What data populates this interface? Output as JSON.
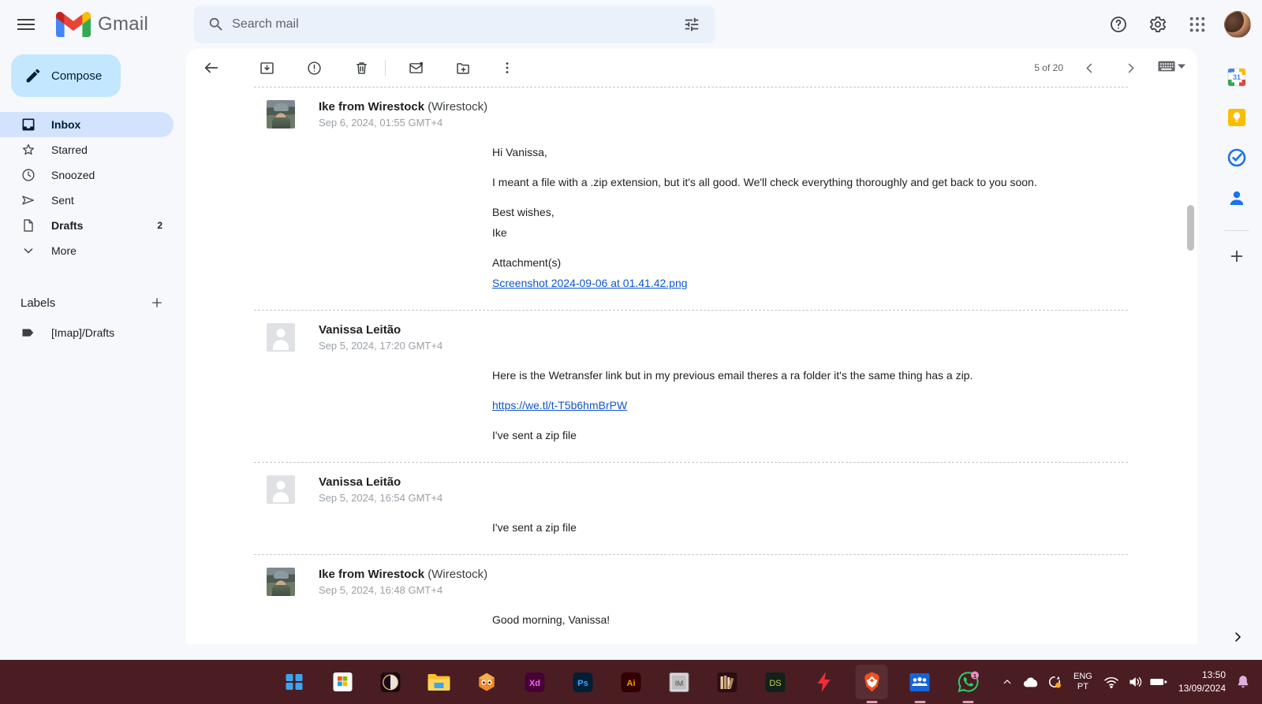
{
  "app": {
    "brand": "Gmail",
    "menu_icon": "hamburger-icon"
  },
  "search": {
    "placeholder": "Search mail",
    "value": "",
    "search_icon": "search-icon",
    "filter_icon": "tune-filter-icon"
  },
  "header_actions": {
    "help": "Support",
    "settings": "Settings",
    "apps": "Google apps",
    "account": "Google Account"
  },
  "sidebar": {
    "compose_label": "Compose",
    "items": [
      {
        "label": "Inbox",
        "icon": "inbox-icon",
        "count": "",
        "active": true
      },
      {
        "label": "Starred",
        "icon": "star-icon",
        "count": "",
        "active": false
      },
      {
        "label": "Snoozed",
        "icon": "clock-icon",
        "count": "",
        "active": false
      },
      {
        "label": "Sent",
        "icon": "send-icon",
        "count": "",
        "active": false
      },
      {
        "label": "Drafts",
        "icon": "document-icon",
        "count": "2",
        "active": false
      },
      {
        "label": "More",
        "icon": "chevron-down-icon",
        "count": "",
        "active": false
      }
    ],
    "labels_title": "Labels",
    "labels_add": "+",
    "labels": [
      {
        "label": "[Imap]/Drafts",
        "icon": "label-tag-icon"
      }
    ]
  },
  "toolbar": {
    "back": "Back to Inbox",
    "archive": "Archive",
    "spam": "Report spam",
    "delete": "Delete",
    "unread": "Mark as unread",
    "move": "Move to",
    "more": "More",
    "page_count": "5 of 20",
    "prev": "Newer",
    "next": "Older",
    "keyboard": "Input tools"
  },
  "thread": {
    "messages": [
      {
        "sender": "Ike from Wirestock",
        "org": "(Wirestock)",
        "date": "Sep 6, 2024, 01:55 GMT+4",
        "avatar": "photo",
        "body": [
          "Hi Vanissa,",
          "I meant a file with a .zip extension, but it's all good. We'll check everything thoroughly and get back to you soon.",
          "Best wishes,",
          "Ike"
        ],
        "attachment_label": "Attachment(s)",
        "attachment_name": "Screenshot 2024-09-06 at 01.41.42.png"
      },
      {
        "sender": "Vanissa Leitão",
        "org": "",
        "date": "Sep 5, 2024, 17:20 GMT+4",
        "avatar": "generic",
        "body": [
          "Here is the Wetransfer link but in my previous email theres a ra folder it's the same thing has a zip."
        ],
        "link": "https://we.tl/t-T5b6hmBrPW",
        "body_after": [
          "I've sent a zip file"
        ]
      },
      {
        "sender": "Vanissa Leitão",
        "org": "",
        "date": "Sep 5, 2024, 16:54 GMT+4",
        "avatar": "generic",
        "body": [
          "I've sent a zip file"
        ]
      },
      {
        "sender": "Ike from Wirestock",
        "org": "(Wirestock)",
        "date": "Sep 5, 2024, 16:48 GMT+4",
        "avatar": "photo",
        "body": [
          "Good morning, Vanissa!"
        ]
      }
    ]
  },
  "right_panel": {
    "items": [
      {
        "name": "google-calendar-icon",
        "label": "Calendar",
        "day": "31"
      },
      {
        "name": "google-keep-icon",
        "label": "Keep"
      },
      {
        "name": "google-tasks-icon",
        "label": "Tasks"
      },
      {
        "name": "google-contacts-icon",
        "label": "Contacts"
      }
    ],
    "add_label": "Get add-ons",
    "expand_label": "Show side panel"
  },
  "taskbar": {
    "apps": [
      {
        "name": "windows-start-icon",
        "label": "Start",
        "running": false,
        "focused": false,
        "badge": ""
      },
      {
        "name": "microsoft-store-icon",
        "label": "Microsoft Store",
        "running": false,
        "focused": false,
        "badge": ""
      },
      {
        "name": "lightroom-icon",
        "label": "Lightroom",
        "running": false,
        "focused": false,
        "badge": ""
      },
      {
        "name": "file-explorer-icon",
        "label": "File Explorer",
        "running": false,
        "focused": false,
        "badge": ""
      },
      {
        "name": "owl-app-icon",
        "label": "Topaz",
        "running": false,
        "focused": false,
        "badge": ""
      },
      {
        "name": "adobe-xd-icon",
        "label": "Adobe XD",
        "running": false,
        "focused": false,
        "badge": ""
      },
      {
        "name": "photoshop-icon",
        "label": "Adobe Photoshop",
        "running": false,
        "focused": false,
        "badge": ""
      },
      {
        "name": "illustrator-icon",
        "label": "Adobe Illustrator",
        "running": false,
        "focused": false,
        "badge": ""
      },
      {
        "name": "indesign-icon",
        "label": "Adobe InDesign",
        "running": false,
        "focused": false,
        "badge": ""
      },
      {
        "name": "books-icon",
        "label": "Library",
        "running": false,
        "focused": false,
        "badge": ""
      },
      {
        "name": "ds-app-icon",
        "label": "DS",
        "running": false,
        "focused": false,
        "badge": ""
      },
      {
        "name": "flash-icon",
        "label": "Flash",
        "running": false,
        "focused": false,
        "badge": ""
      },
      {
        "name": "brave-browser-icon",
        "label": "Brave",
        "running": true,
        "focused": true,
        "badge": ""
      },
      {
        "name": "contacts-app-icon",
        "label": "People",
        "running": true,
        "focused": false,
        "badge": ""
      },
      {
        "name": "whatsapp-icon",
        "label": "WhatsApp",
        "running": true,
        "focused": false,
        "badge": "1"
      }
    ],
    "tray": {
      "overflow": "Show hidden icons",
      "cloud": "OneDrive",
      "sync": "Sync pending",
      "lang_line1": "ENG",
      "lang_line2": "PT",
      "wifi": "Network",
      "volume": "Volume",
      "battery": "Battery",
      "time": "13:50",
      "date": "13/09/2024",
      "notifications": "Notifications"
    }
  },
  "colors": {
    "accent": "#0b57d0",
    "compose_bg": "#c2e7ff",
    "nav_active": "#d3e3fd",
    "panel_bg": "#ffffff",
    "shell_bg": "#f6f8fc",
    "taskbar_bg": "#4a1d22",
    "link": "#1155cc",
    "badge": "#e88fc0"
  }
}
